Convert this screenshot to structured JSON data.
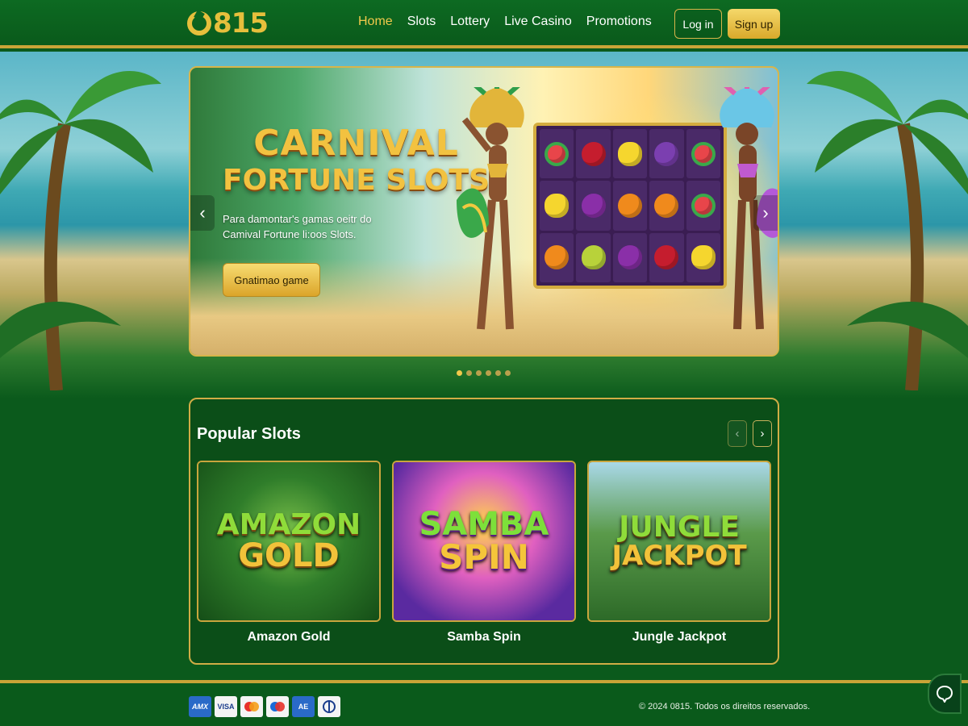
{
  "header": {
    "logo_text": "0815",
    "nav": [
      "Home",
      "Slots",
      "Lottery",
      "Live Casino",
      "Promotions"
    ],
    "active_nav": "Home",
    "login_label": "Log in",
    "signup_label": "Sign up"
  },
  "hero": {
    "title_line1": "CARNIVAL",
    "title_line2": "FORTUNE SLOTS",
    "description": "Para damontar's gamas oeitr do Camival Fortune li:oos Slots.",
    "cta_label": "Gnatimao game",
    "prev_icon": "chevron-left-icon",
    "next_icon": "chevron-right-icon",
    "reel_symbols": [
      "watermelon",
      "cherry",
      "lemon",
      "grapes",
      "watermelon",
      "lemon",
      "plum",
      "orange",
      "orange",
      "watermelon",
      "orange",
      "pear",
      "plum",
      "cherry",
      "lemon"
    ],
    "slide_count": 6,
    "active_slide": 1
  },
  "popular": {
    "title": "Popular Slots",
    "prev_icon": "chevron-left-icon",
    "next_icon": "chevron-right-icon",
    "games": [
      {
        "logo_line1": "AMAZON",
        "logo_line2": "GOLD",
        "name": "Amazon Gold"
      },
      {
        "logo_line1": "SAMBA",
        "logo_line2": "SPIN",
        "name": "Samba Spin"
      },
      {
        "logo_line1": "JUNGLE",
        "logo_line2": "JACKPOT",
        "name": "Jungle Jackpot"
      }
    ]
  },
  "footer": {
    "payment_methods": [
      "amex",
      "visa",
      "mastercard",
      "maestro",
      "american-express",
      "diners-club"
    ],
    "copyright": "© 2024 0815. Todos os direitos reservados.",
    "chat_icon": "chat-icon"
  },
  "colors": {
    "brand_green": "#0b5a1c",
    "gold": "#d8b54a",
    "nav_active": "#f0c94b"
  }
}
